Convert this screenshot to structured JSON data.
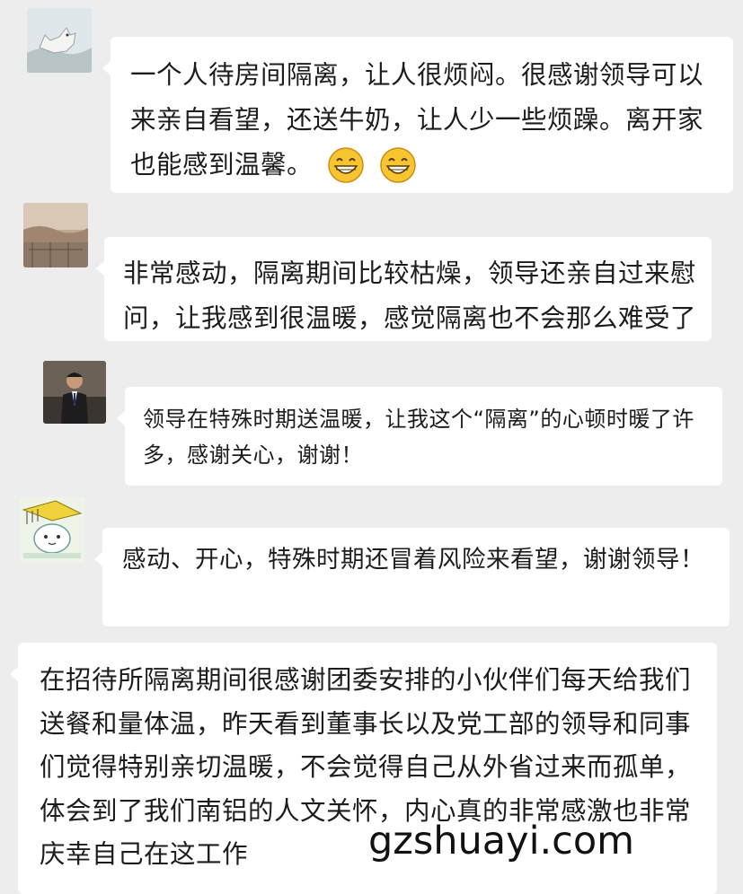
{
  "chat": {
    "messages": [
      {
        "sender": "",
        "text": "一个人待房间隔离，让人很烦闷。很感谢领导可以来亲自看望，还送牛奶，让人少一些烦躁。离开家也能感到温馨。",
        "emojis": [
          "grin-emoji",
          "grin-emoji"
        ]
      },
      {
        "sender": "",
        "text": "非常感动，隔离期间比较枯燥，领导还亲自过来慰问，让我感到很温暖，感觉隔离也不会那么难受了"
      },
      {
        "sender": "",
        "text": "领导在特殊时期送温暖，让我这个“隔离”的心顿时暖了许多，感谢关心，谢谢！"
      },
      {
        "sender": "",
        "text": "感动、开心，特殊时期还冒着风险来看望，谢谢领导！"
      },
      {
        "text": "在招待所隔离期间很感谢团委安排的小伙伴们每天给我们送餐和量体温，昨天看到董事长以及党工部的领导和同事们觉得特别亲切温暖，不会觉得自己从外省过来而孤单，体会到了我们南铝的人文关怀，内心真的非常感激也非常庆幸自己在这工作"
      }
    ]
  },
  "watermark": "gzshuayi.com",
  "colors": {
    "background": "#ededed",
    "bubble": "#ffffff",
    "text": "#1c1c1c",
    "emoji_face": "#f7c531"
  }
}
